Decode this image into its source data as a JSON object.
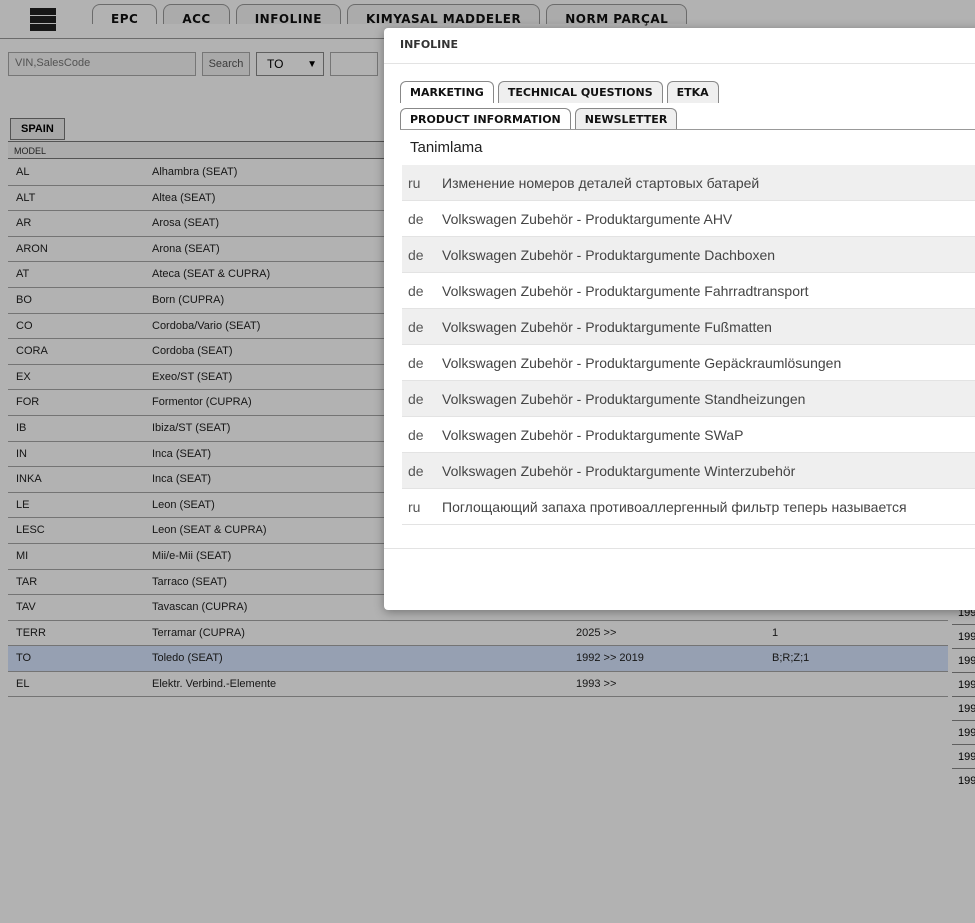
{
  "main_tabs": [
    "EPC",
    "ACC",
    "INFOLINE",
    "KIMYASAL MADDELER",
    "NORM PARÇAL"
  ],
  "search": {
    "placeholder": "VIN,SalesCode",
    "button": "Search",
    "select_value": "TO"
  },
  "country_tab": "SPAIN",
  "table": {
    "header": "MODEL",
    "rows": [
      {
        "code": "AL",
        "name": "Alhambra (SEAT)",
        "years": "",
        "types": ""
      },
      {
        "code": "ALT",
        "name": "Altea (SEAT)",
        "years": "",
        "types": ""
      },
      {
        "code": "AR",
        "name": "Arosa (SEAT)",
        "years": "",
        "types": ""
      },
      {
        "code": "ARON",
        "name": "Arona (SEAT)",
        "years": "",
        "types": ""
      },
      {
        "code": "AT",
        "name": "Ateca (SEAT & CUPRA)",
        "years": "",
        "types": ""
      },
      {
        "code": "BO",
        "name": "Born (CUPRA)",
        "years": "",
        "types": ""
      },
      {
        "code": "CO",
        "name": "Cordoba/Vario (SEAT)",
        "years": "",
        "types": ""
      },
      {
        "code": "CORA",
        "name": "Cordoba (SEAT)",
        "years": "",
        "types": ""
      },
      {
        "code": "EX",
        "name": "Exeo/ST (SEAT)",
        "years": "",
        "types": ""
      },
      {
        "code": "FOR",
        "name": "Formentor (CUPRA)",
        "years": "",
        "types": ""
      },
      {
        "code": "IB",
        "name": "Ibiza/ST (SEAT)",
        "years": "",
        "types": ""
      },
      {
        "code": "IN",
        "name": "Inca (SEAT)",
        "years": "",
        "types": ""
      },
      {
        "code": "INKA",
        "name": "Inca (SEAT)",
        "years": "",
        "types": ""
      },
      {
        "code": "LE",
        "name": "Leon (SEAT)",
        "years": "",
        "types": ""
      },
      {
        "code": "LESC",
        "name": "Leon (SEAT & CUPRA)",
        "years": "",
        "types": ""
      },
      {
        "code": "MI",
        "name": "Mii/e-Mii (SEAT)",
        "years": "",
        "types": ""
      },
      {
        "code": "TAR",
        "name": "Tarraco (SEAT)",
        "years": "",
        "types": ""
      },
      {
        "code": "TAV",
        "name": "Tavascan (CUPRA)",
        "years": "",
        "types": ""
      },
      {
        "code": "TERR",
        "name": "Terramar (CUPRA)",
        "years": "2025 >>",
        "types": "1"
      },
      {
        "code": "TO",
        "name": "Toledo (SEAT)",
        "years": "1992 >> 2019",
        "types": "B;R;Z;1"
      },
      {
        "code": "EL",
        "name": "Elektr. Verbind.-Elemente",
        "years": "1993 >>",
        "types": ""
      }
    ]
  },
  "right_col_values": [
    "199",
    "199",
    "199",
    "199",
    "199",
    "199",
    "199",
    "199"
  ],
  "modal": {
    "title": "INFOLINE",
    "tabs_row1": [
      "MARKETING",
      "TECHNICAL QUESTIONS",
      "ETKA"
    ],
    "tabs_row2": [
      "PRODUCT INFORMATION",
      "NEWSLETTER"
    ],
    "section_title": "Tanimlama",
    "items": [
      {
        "lang": "ru",
        "title": "Изменение номеров деталей стартовых батарей"
      },
      {
        "lang": "de",
        "title": "Volkswagen Zubehör - Produktargumente AHV"
      },
      {
        "lang": "de",
        "title": "Volkswagen Zubehör - Produktargumente Dachboxen"
      },
      {
        "lang": "de",
        "title": "Volkswagen Zubehör - Produktargumente Fahrradtransport"
      },
      {
        "lang": "de",
        "title": "Volkswagen Zubehör - Produktargumente Fußmatten"
      },
      {
        "lang": "de",
        "title": "Volkswagen Zubehör - Produktargumente Gepäckraumlösungen"
      },
      {
        "lang": "de",
        "title": "Volkswagen Zubehör - Produktargumente Standheizungen"
      },
      {
        "lang": "de",
        "title": "Volkswagen Zubehör - Produktargumente SWaP"
      },
      {
        "lang": "de",
        "title": "Volkswagen Zubehör - Produktargumente Winterzubehör"
      },
      {
        "lang": "ru",
        "title": "Поглощающий запаха противоаллергенный фильтр теперь называется"
      }
    ]
  }
}
